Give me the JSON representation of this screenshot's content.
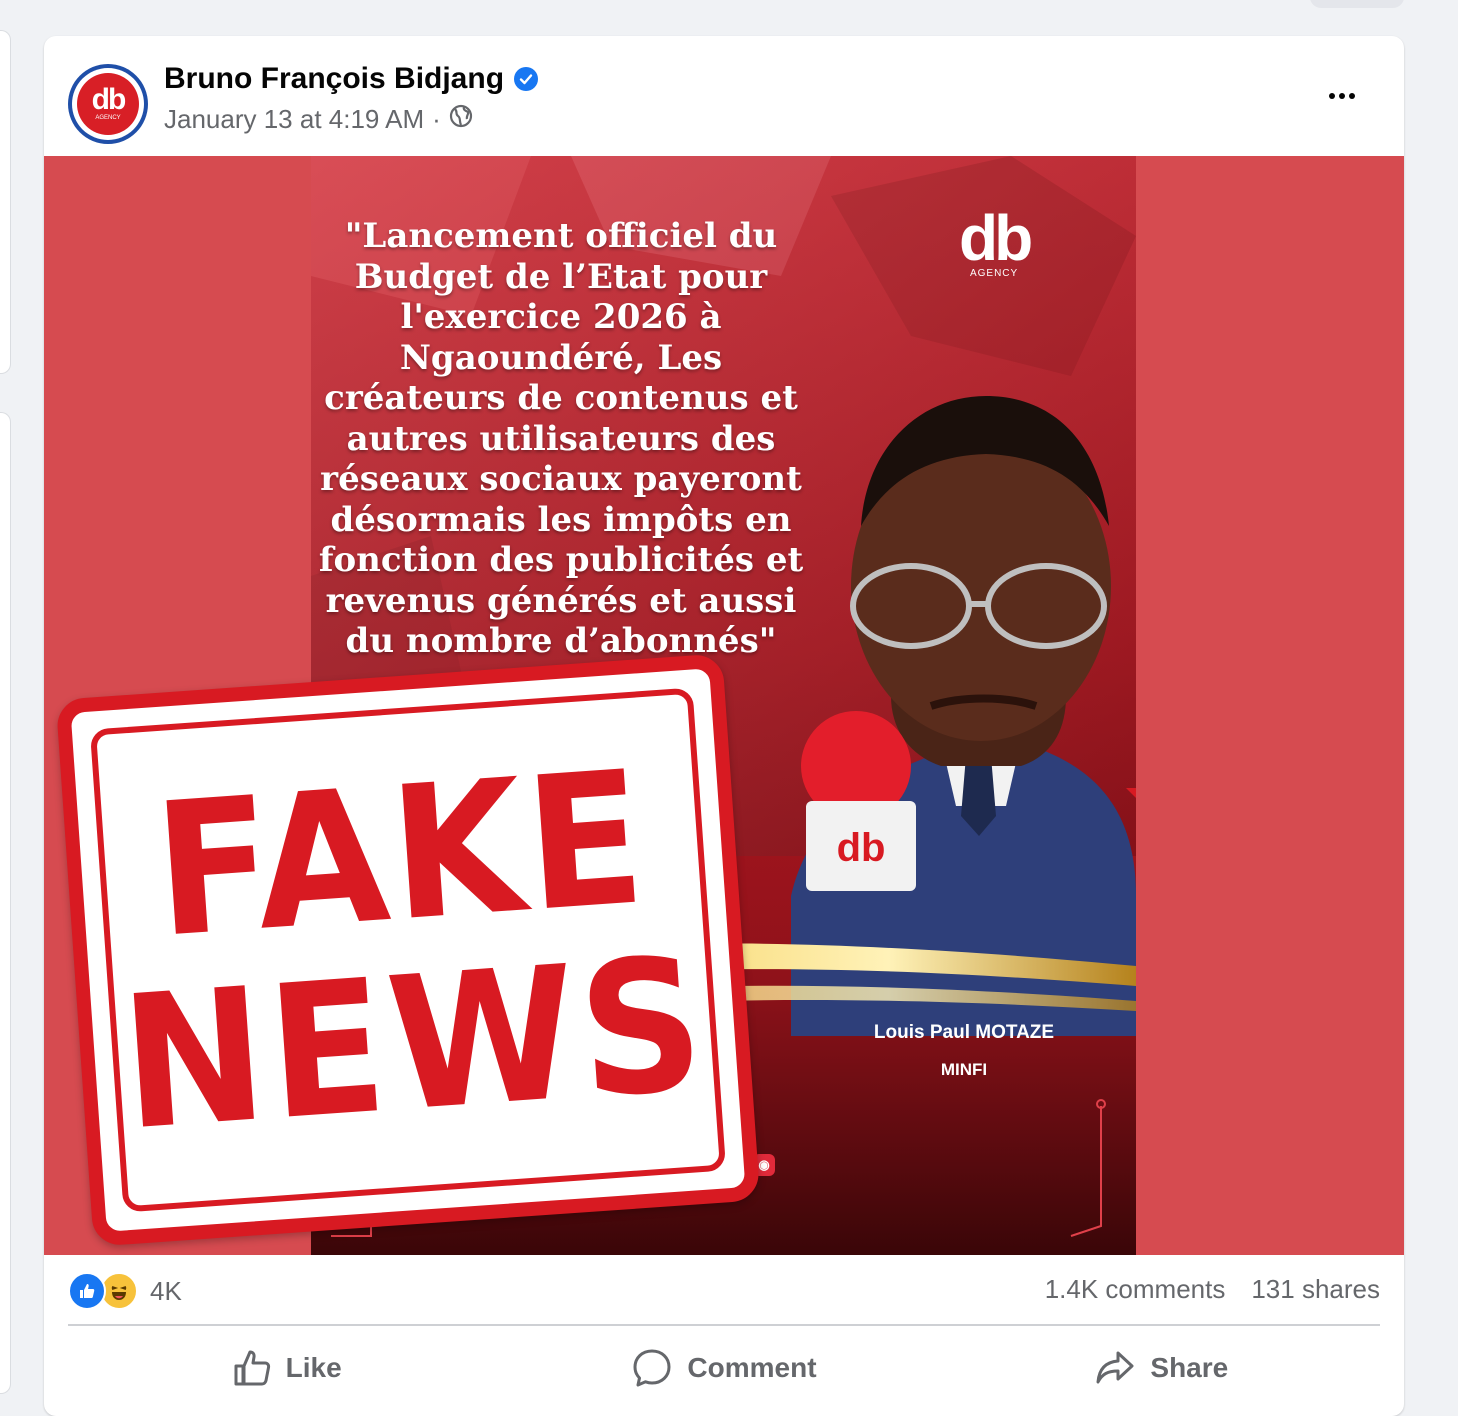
{
  "post": {
    "author": "Bruno François Bidjang",
    "timestamp": "January 13 at 4:19 AM",
    "separator": "·",
    "avatar_text": "db",
    "avatar_subtext": "AGENCY",
    "verified_icon": "verified-badge-icon",
    "privacy_icon": "globe-icon",
    "menu_icon": "more-options-icon"
  },
  "media": {
    "quote": "\"Lancement officiel du Budget de l’Etat pour l'exercice 2026 à Ngaoundéré, Les créateurs de contenus et autres utilisateurs des réseaux sociaux payeront désormais les impôts en fonction des publicités et revenus générés et aussi du nombre d’abonnés\"",
    "logo_text": "db",
    "logo_subtext": "AGENCY",
    "person_name": "Louis Paul MOTAZE",
    "person_role": "MINFI",
    "mic_logo": "db",
    "stamp_line1": "FAKE",
    "stamp_line2": "NEWS",
    "social_icons": [
      "facebook-icon",
      "instagram-icon",
      "youtube-icon",
      "tiktok-icon",
      "podcast-icon"
    ],
    "colors": {
      "page_bg": "#d64b50",
      "poster_red": "#c91f2a",
      "stamp_red": "#d81a22"
    }
  },
  "stats": {
    "reactions": [
      "like",
      "haha"
    ],
    "reaction_count": "4K",
    "comments": "1.4K comments",
    "shares": "131 shares"
  },
  "actions": {
    "like": "Like",
    "comment": "Comment",
    "share": "Share"
  }
}
